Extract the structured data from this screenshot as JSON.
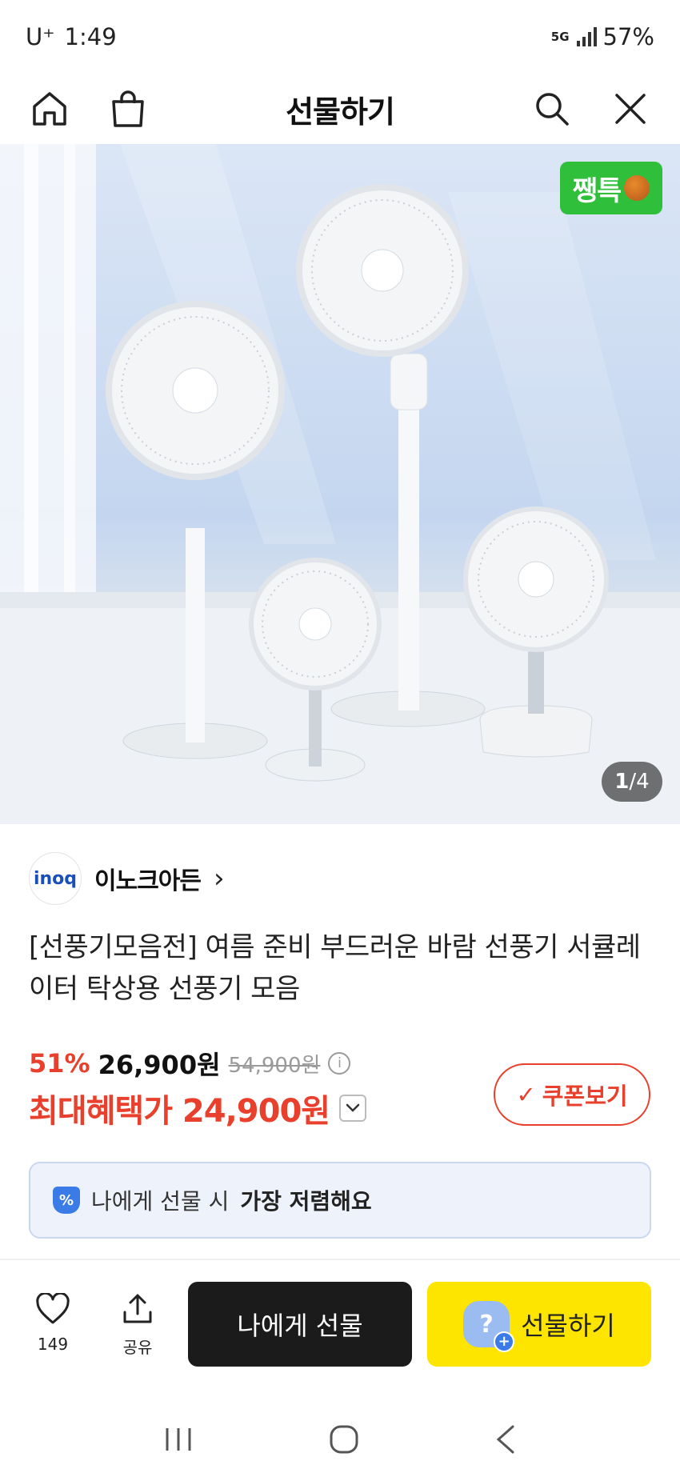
{
  "status_bar": {
    "carrier": "U⁺",
    "time": "1:49",
    "network": "5G",
    "battery": "57%"
  },
  "top_nav": {
    "title": "선물하기"
  },
  "hero": {
    "badge": "쨍특",
    "page_current": "1",
    "page_separator": "/",
    "page_total": "4"
  },
  "seller": {
    "logo_text": "inoq",
    "name": "이노크아든",
    "chevron": "›"
  },
  "product": {
    "title": "[선풍기모음전] 여름 준비 부드러운 바람 선풍기 서큘레이터 탁상용 선풍기 모음"
  },
  "price": {
    "discount": "51%",
    "sale_price": "26,900원",
    "original_price": "54,900원",
    "best_price": "최대혜택가 24,900원"
  },
  "coupon": {
    "label": "쿠폰보기",
    "check": "✓"
  },
  "promo": {
    "prefix": "나에게 선물 시",
    "emphasis": "가장 저렴해요"
  },
  "actions": {
    "like_count": "149",
    "share_label": "공유",
    "self_gift_label": "나에게 선물",
    "gift_label": "선물하기"
  },
  "colors": {
    "accent_red": "#e8402c",
    "kakao_yellow": "#fee500",
    "badge_green": "#2fbf3b"
  }
}
